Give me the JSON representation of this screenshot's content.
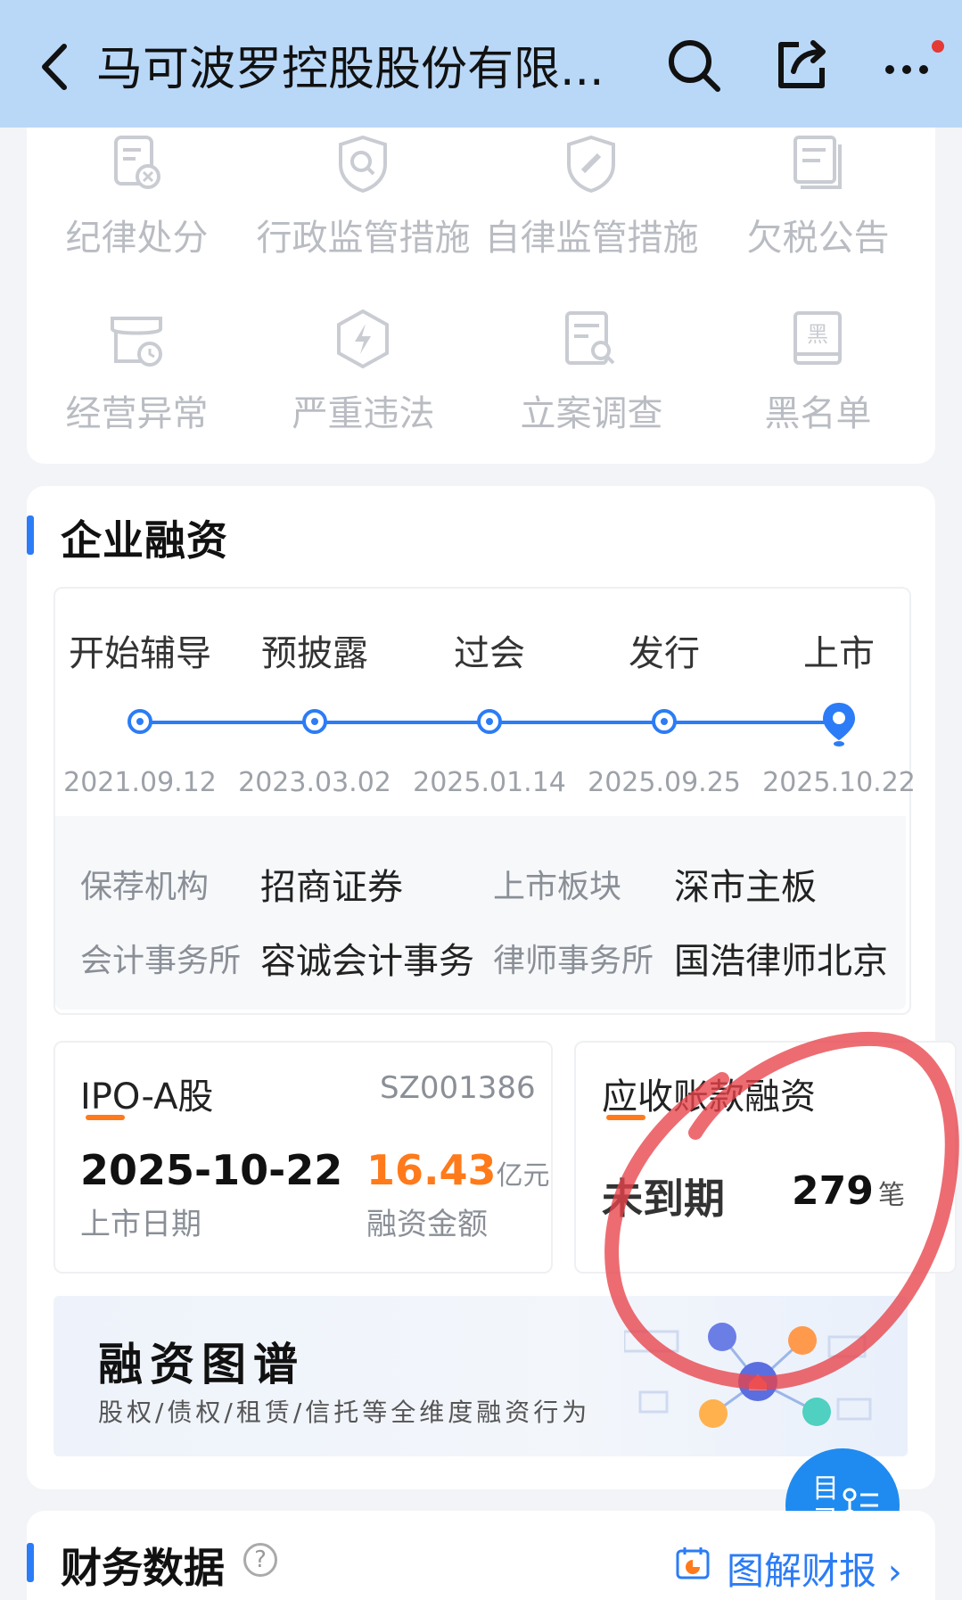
{
  "header": {
    "title": "马可波罗控股股份有限...",
    "bg": "#b9d8f8"
  },
  "risk_items": [
    {
      "label": "纪律处分",
      "icon": "document-x-icon"
    },
    {
      "label": "行政监管措施",
      "icon": "shield-search-icon"
    },
    {
      "label": "自律监管措施",
      "icon": "shield-pen-icon"
    },
    {
      "label": "欠税公告",
      "icon": "stack-document-icon"
    },
    {
      "label": "经营异常",
      "icon": "shop-clock-icon"
    },
    {
      "label": "严重违法",
      "icon": "hexagon-bolt-icon"
    },
    {
      "label": "立案调查",
      "icon": "file-search-icon"
    },
    {
      "label": "黑名单",
      "icon": "blacklist-book-icon"
    }
  ],
  "financing": {
    "section_title": "企业融资",
    "timeline": [
      {
        "label": "开始辅导",
        "date": "2021.09.12"
      },
      {
        "label": "预披露",
        "date": "2023.03.02"
      },
      {
        "label": "过会",
        "date": "2025.01.14"
      },
      {
        "label": "发行",
        "date": "2025.09.25"
      },
      {
        "label": "上市",
        "date": "2025.10.22"
      }
    ],
    "info": {
      "sponsor_key": "保荐机构",
      "sponsor_val": "招商证券",
      "board_key": "上市板块",
      "board_val": "深市主板",
      "accountant_key": "会计事务所",
      "accountant_val": "容诚会计事务",
      "lawyer_key": "律师事务所",
      "lawyer_val": "国浩律师北京"
    },
    "ipo": {
      "title": "IPO-A股",
      "code": "SZ001386",
      "date": "2025-10-22",
      "date_label": "上市日期",
      "amount": "16.43",
      "amount_unit": "亿元",
      "amount_label": "融资金额"
    },
    "receivable": {
      "title": "应收账款融资",
      "status": "未到期",
      "count": "279",
      "count_unit": "笔"
    },
    "graph": {
      "title": "融资图谱",
      "subtitle": "股权/债权/租赁/信托等全维度融资行为"
    }
  },
  "toc": {
    "label": "目录"
  },
  "finance_data": {
    "title": "财务数据",
    "help": "?",
    "link": "图解财报"
  },
  "colors": {
    "accent": "#2b7cf6",
    "orange": "#ff7a1a",
    "annotation": "#e8434a"
  }
}
